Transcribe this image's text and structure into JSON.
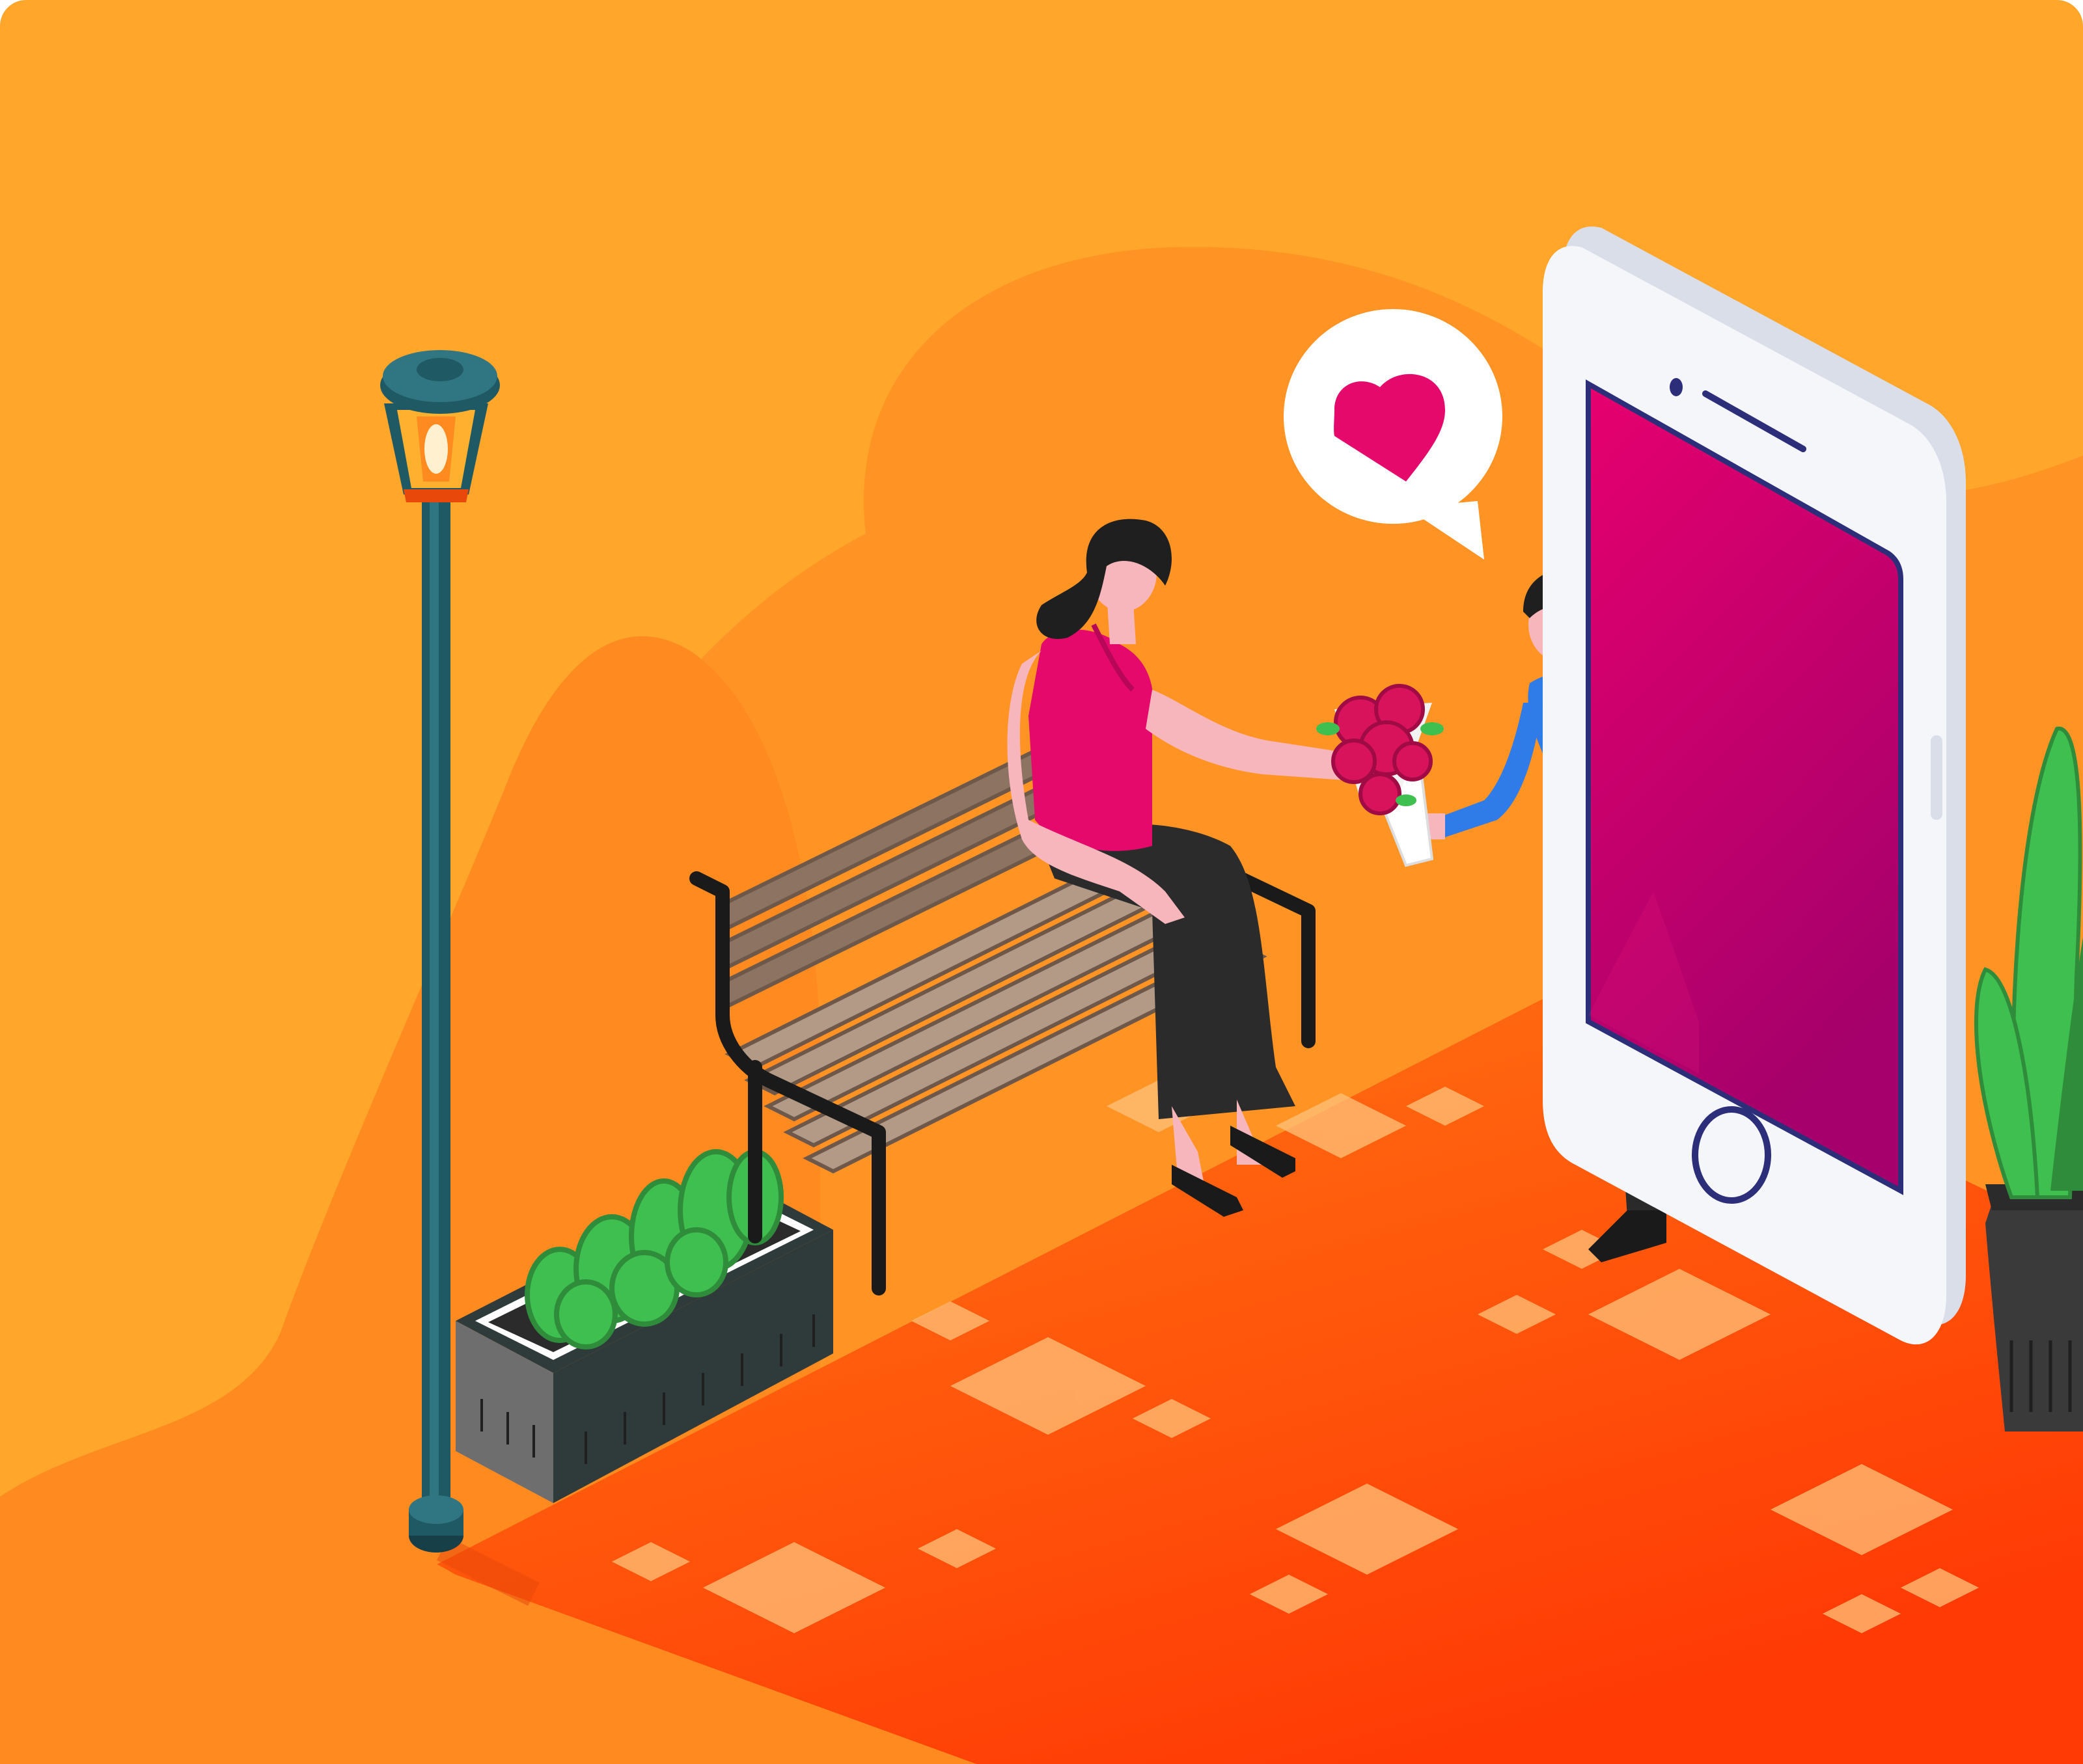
{
  "scene": {
    "description_hidden": "",
    "colors": {
      "background": "#FFA62B",
      "blob_light": "#FF9425",
      "blob_mid": "#FF8A1F",
      "ground": "#FF5A0F",
      "ground_dark": "#FF3E05",
      "tile": "#FFC27A",
      "lamp_post": "#1F5A64",
      "lamp_glow": "#FFB02E",
      "bench_wood": "#B39A86",
      "bench_wood_dark": "#6E5849",
      "bench_frame": "#1A1A1A",
      "planter": "#2F3A3A",
      "planter_side": "#6E6E6E",
      "plant_green": "#3FBF4F",
      "plant_dark": "#2E8C3B",
      "phone_body": "#F4F6FA",
      "phone_side": "#D9DEE8",
      "screen_top": "#E6006E",
      "screen_bottom": "#A5006B",
      "screen_border": "#2C2E7A",
      "woman_top": "#E5096B",
      "skin": "#F7B5BC",
      "hair": "#1F1F1F",
      "skirt": "#2B2B2B",
      "man_shirt": "#2F7BE8",
      "man_pants": "#2A2A2A",
      "heart": "#E5096B",
      "bubble": "#FFFFFF",
      "flowers": "#D9125C",
      "pot": "#3A3A3A"
    },
    "icons": {
      "speech": "heart-icon",
      "phone_home": "home-button-icon"
    }
  }
}
